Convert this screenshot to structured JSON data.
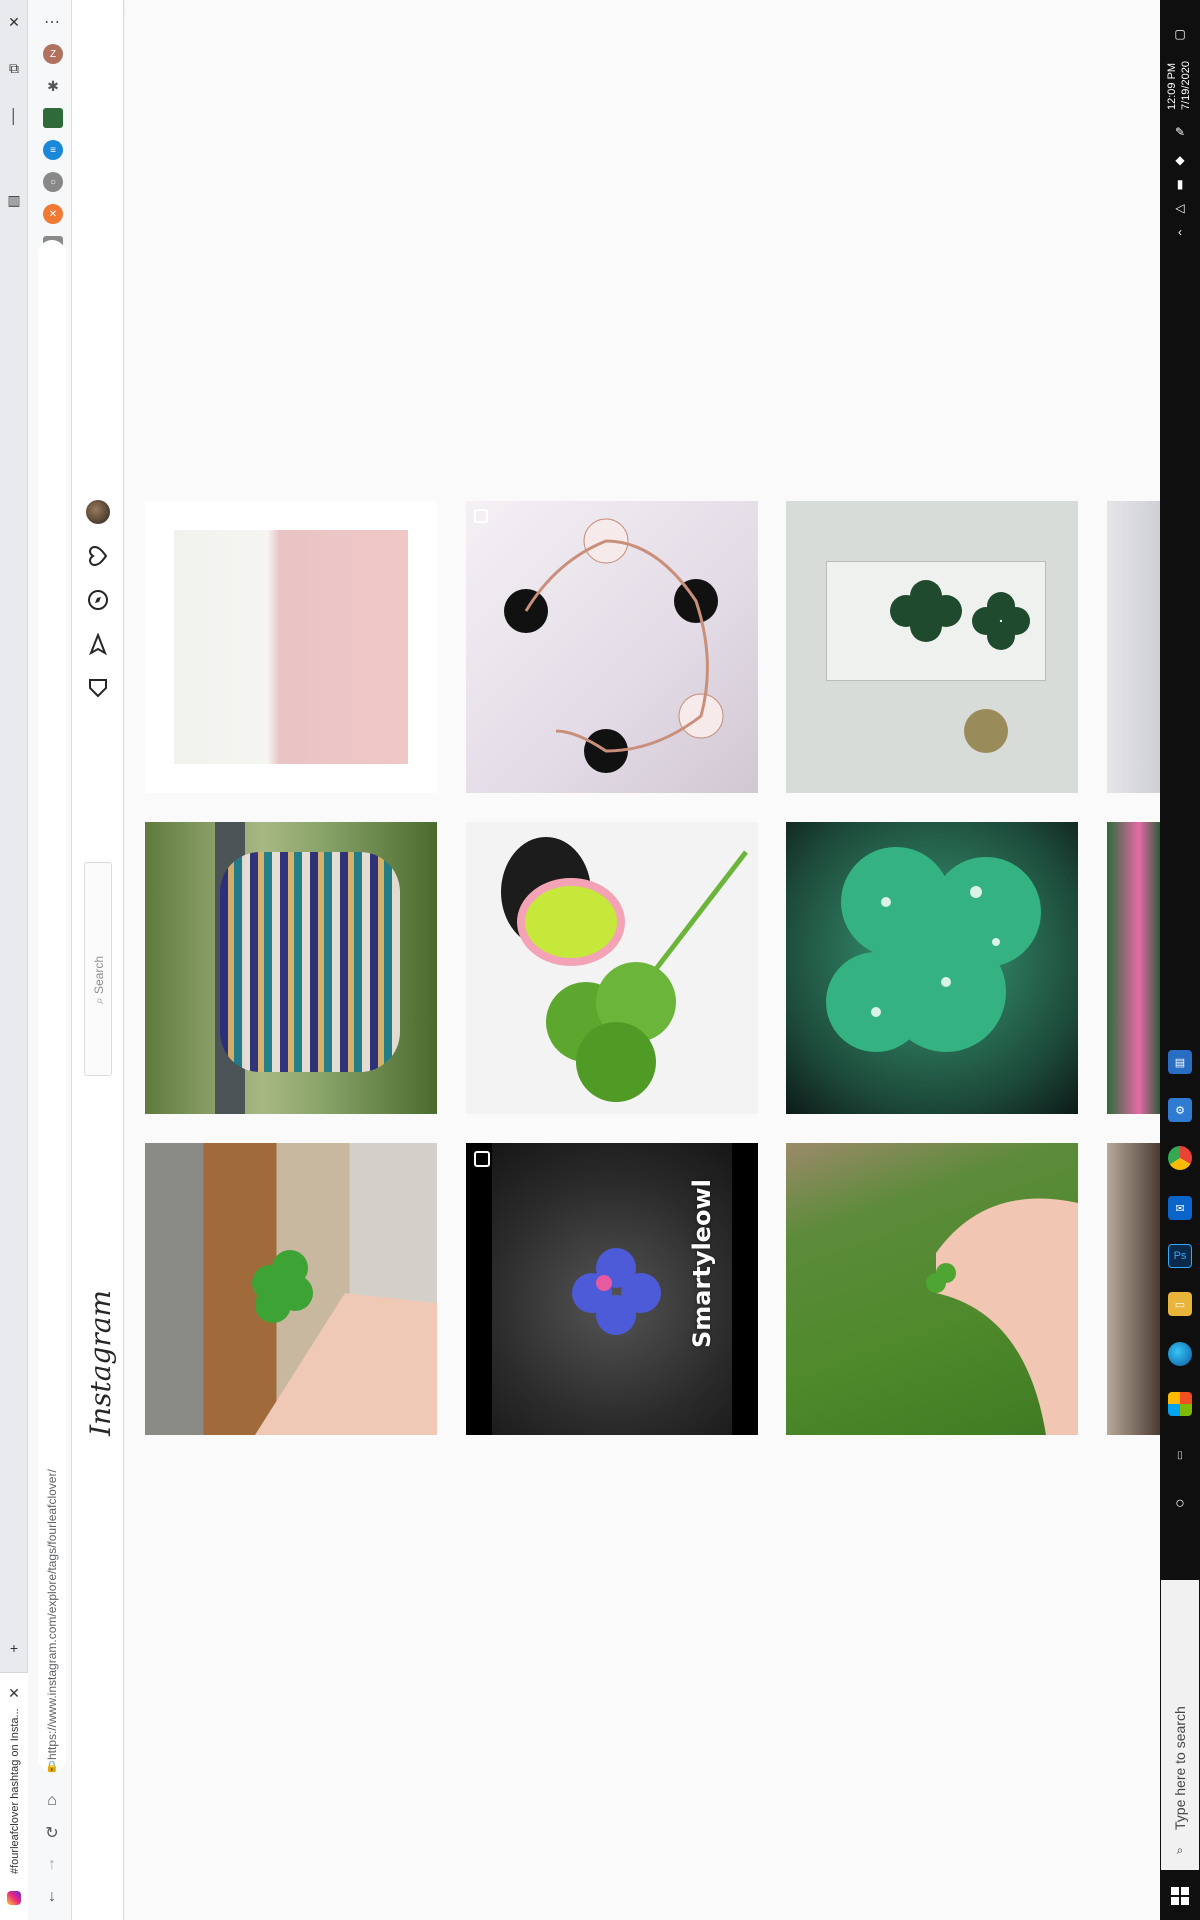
{
  "browser": {
    "tab_title": "#fourleafclover hashtag on Insta...",
    "url": "https://www.instagram.com/explore/tags/fourleafclover/",
    "ext_letter_z": "Z",
    "ext_letter_g": "G"
  },
  "instagram": {
    "logo": "Instagram",
    "search_placeholder": "Search"
  },
  "tiles": [
    {
      "caption": ""
    },
    {
      "caption": ""
    },
    {
      "caption": ""
    },
    {
      "caption": ""
    },
    {
      "caption": ""
    },
    {
      "caption": ""
    },
    {
      "caption": ""
    },
    {
      "caption": "Smartyleowl"
    },
    {
      "caption": ""
    }
  ],
  "taskbar": {
    "time": "12:09 PM",
    "date": "7/19/2020",
    "search_placeholder": "Type here to search",
    "app_ps": "Ps"
  },
  "colors": {
    "instagram_bg": "#fafafa",
    "taskbar_bg": "#0f0f0f",
    "tab_strip_bg": "#e8eaed"
  }
}
